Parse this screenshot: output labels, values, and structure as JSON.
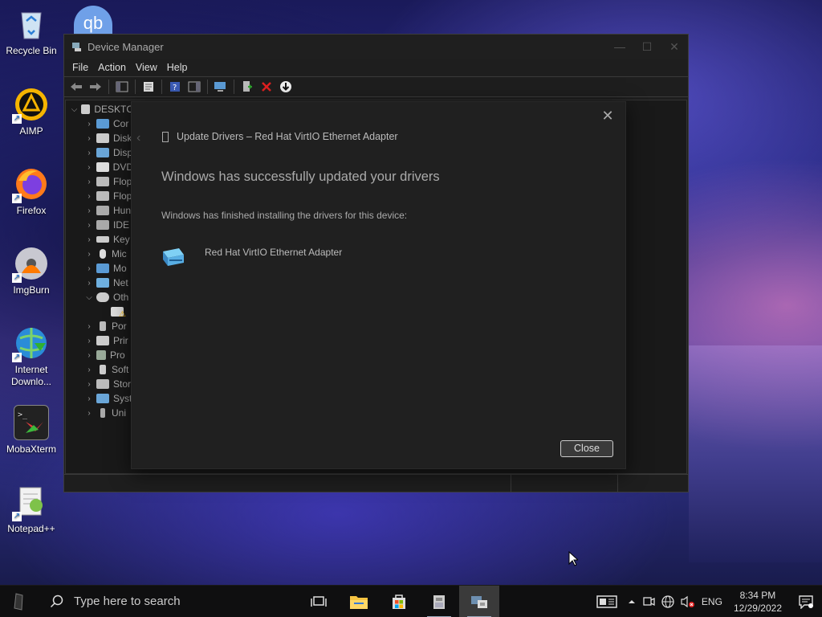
{
  "desktop": {
    "icons": [
      {
        "label": "Recycle Bin"
      },
      {
        "label": "AIMP"
      },
      {
        "label": "Firefox"
      },
      {
        "label": "ImgBurn"
      },
      {
        "label": "Internet Downlo..."
      },
      {
        "label": "MobaXterm"
      },
      {
        "label": "Notepad++"
      }
    ],
    "qb_label": "qb"
  },
  "window": {
    "title": "Device Manager",
    "menu": [
      "File",
      "Action",
      "View",
      "Help"
    ],
    "tree": {
      "root": "DESKTC",
      "items": [
        "Cor",
        "Disk",
        "Disp",
        "DVD",
        "Flop",
        "Flop",
        "Hun",
        "IDE",
        "Key",
        "Mic",
        "Mo",
        "Net",
        "Oth",
        "",
        "Por",
        "Prir",
        "Pro",
        "Soft",
        "Stor",
        "Syst",
        "Uni"
      ]
    }
  },
  "dialog": {
    "header": "Update Drivers – Red Hat VirtIO Ethernet Adapter",
    "main_text": "Windows has successfully updated your drivers",
    "sub_text": "Windows has finished installing the drivers for this device:",
    "device_name": "Red Hat VirtIO Ethernet Adapter",
    "close_label": "Close",
    "close_x": "✕"
  },
  "taskbar": {
    "search_placeholder": "Type here to search",
    "language": "ENG",
    "time": "8:34 PM",
    "date": "12/29/2022"
  }
}
